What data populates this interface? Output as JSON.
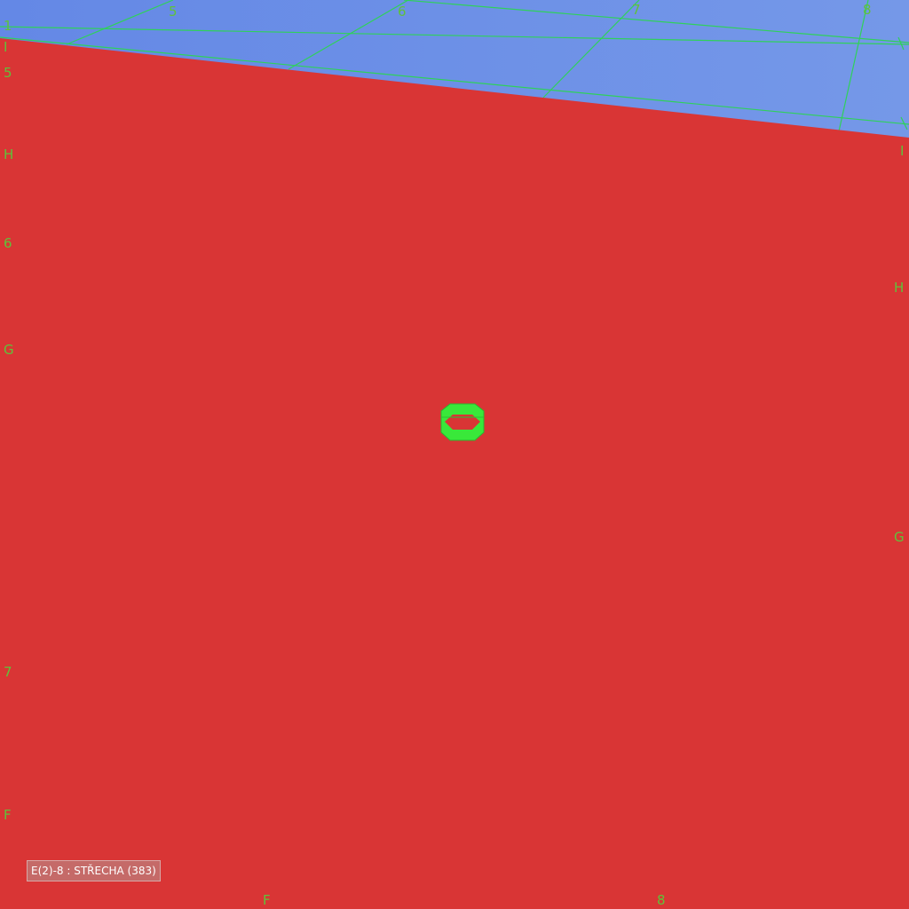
{
  "colors": {
    "sky": "#6a8de6",
    "roof": "#d93535",
    "grid_line": "#2fd15a",
    "grid_label": "#5fc23a",
    "marker": "#39e83a",
    "status_bg": "#c56a68"
  },
  "grid_labels": {
    "top_1": "1",
    "top_5": "5",
    "top_6": "6",
    "top_7": "7",
    "top_8": "8",
    "left_i": "I",
    "left_5": "5",
    "left_h": "H",
    "left_6": "6",
    "left_g": "G",
    "left_7": "7",
    "left_f": "F",
    "right_i": "I",
    "right_h": "H",
    "right_g": "G",
    "bottom_f": "F",
    "bottom_8": "8"
  },
  "marker": {
    "icon": "octagon-marker-icon"
  },
  "status": {
    "text": "E(2)-8 : STŘECHA (383)"
  }
}
